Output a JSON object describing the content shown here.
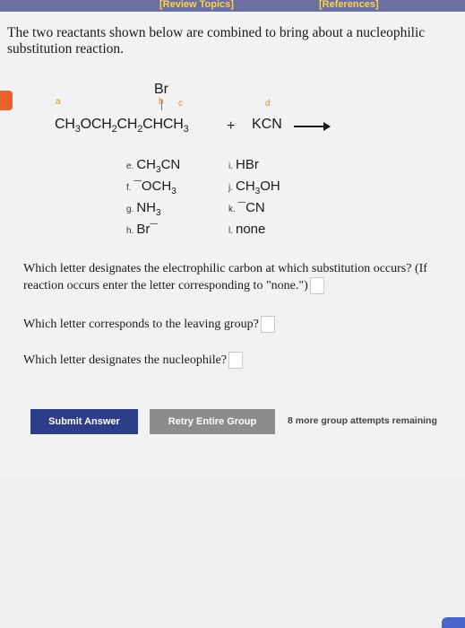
{
  "topbar": {
    "review_topics": "[Review Topics]",
    "references": "[References]"
  },
  "intro": "The two reactants shown below are combined to bring about a nucleophilic substitution reaction.",
  "reaction": {
    "br": "Br",
    "labels": {
      "a": "a",
      "b": "b",
      "c": "c",
      "d": "d"
    },
    "reactant1_parts": [
      "CH",
      "3",
      "OCH",
      "2",
      "CH",
      "2",
      "CHCH",
      "3"
    ],
    "plus": "+",
    "reactant2": "KCN"
  },
  "options": [
    {
      "letter": "e.",
      "main": "CH",
      "sub": "3",
      "tail": "CN"
    },
    {
      "letter": "f.",
      "main": "¯OCH",
      "sub": "3",
      "tail": ""
    },
    {
      "letter": "g.",
      "main": "NH",
      "sub": "3",
      "tail": ""
    },
    {
      "letter": "h.",
      "main": "Br¯",
      "sub": "",
      "tail": ""
    },
    {
      "letter": "i.",
      "main": "HBr",
      "sub": "",
      "tail": ""
    },
    {
      "letter": "j.",
      "main": "CH",
      "sub": "3",
      "tail": "OH"
    },
    {
      "letter": "k.",
      "main": "¯CN",
      "sub": "",
      "tail": ""
    },
    {
      "letter": "l.",
      "main": "none",
      "sub": "",
      "tail": ""
    }
  ],
  "questions": {
    "q1": "Which letter designates the electrophilic carbon at which substitution occurs? (If reaction occurs enter the letter corresponding to \"none.\")",
    "q2": "Which letter corresponds to the leaving group?",
    "q3": "Which letter designates the nucleophile?"
  },
  "answers": {
    "q1": "",
    "q2": "",
    "q3": ""
  },
  "buttons": {
    "submit": "Submit Answer",
    "retry": "Retry Entire Group"
  },
  "remaining": "8 more group attempts remaining",
  "colors": {
    "submit": "#2e3d8a",
    "retry": "#8c8c8c",
    "topbar": "#6b6fa0",
    "topbar_text": "#ffd24a",
    "orange": "#e8622a"
  }
}
